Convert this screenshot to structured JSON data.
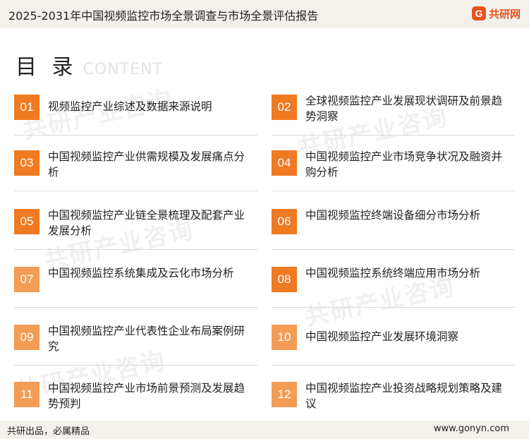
{
  "header": {
    "title": "2025-2031年中国视频监控市场全景调查与市场全景评估报告",
    "logo_mark": "G",
    "logo_text": "共研网"
  },
  "toc": {
    "heading_cn": "目 录",
    "heading_en": "CONTENT",
    "items": [
      {
        "num": "01",
        "label": "视频监控产业综述及数据来源说明"
      },
      {
        "num": "02",
        "label": "全球视频监控产业发展现状调研及前景趋势洞察"
      },
      {
        "num": "03",
        "label": "中国视频监控产业供需规模及发展痛点分析"
      },
      {
        "num": "04",
        "label": "中国视频监控产业市场竞争状况及融资并购分析"
      },
      {
        "num": "05",
        "label": "中国视频监控产业链全景梳理及配套产业发展分析"
      },
      {
        "num": "06",
        "label": "中国视频监控终端设备细分市场分析"
      },
      {
        "num": "07",
        "label": "中国视频监控系统集成及云化市场分析"
      },
      {
        "num": "08",
        "label": "中国视频监控系统终端应用市场分析"
      },
      {
        "num": "09",
        "label": "中国视频监控产业代表性企业布局案例研究"
      },
      {
        "num": "10",
        "label": "中国视频监控产业发展环境洞察"
      },
      {
        "num": "11",
        "label": "中国视频监控产业市场前景预测及发展趋势预判"
      },
      {
        "num": "12",
        "label": "中国视频监控产业投资战略规划策略及建议"
      }
    ]
  },
  "watermark_text": "共研产业咨询",
  "footer": {
    "slogan": "共研出品，必属精品",
    "url": "www.gonyn.com"
  },
  "colors": {
    "accent": "#ef7a22",
    "bar_bg": "#f4f1ec",
    "logo": "#e8521f"
  }
}
